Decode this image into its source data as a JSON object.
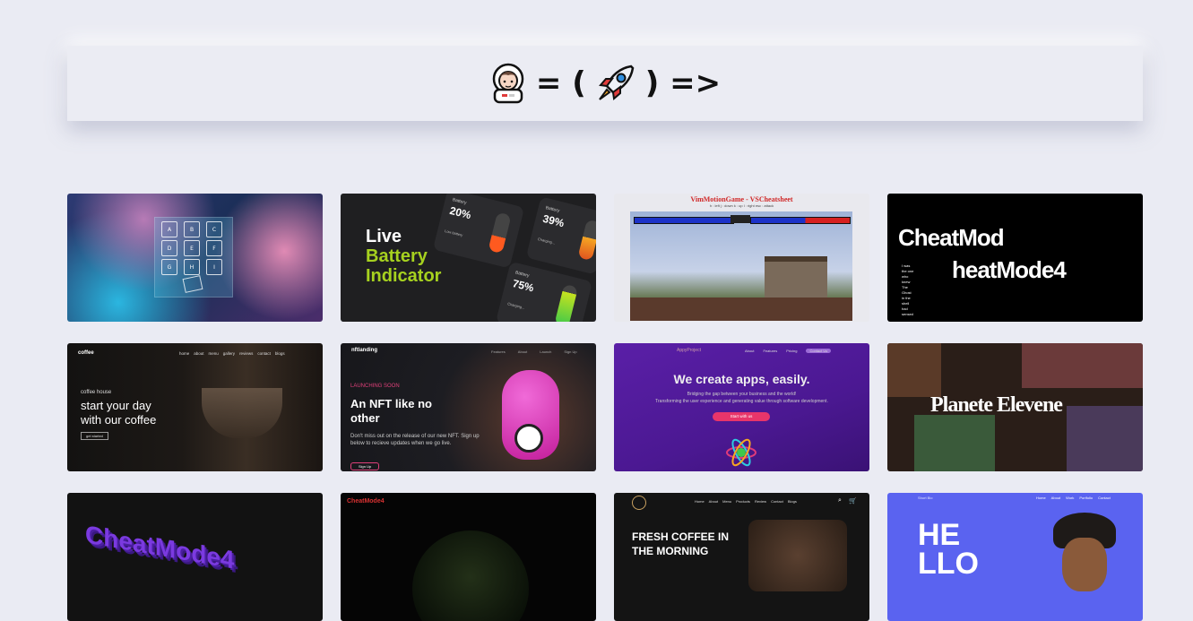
{
  "header": {
    "logo_text": "= (",
    "logo_text_end": ") =>"
  },
  "cards": [
    {
      "name": "keypad-project",
      "keys": [
        "A",
        "B",
        "C",
        "D",
        "E",
        "F",
        "G",
        "H",
        "I"
      ]
    },
    {
      "name": "battery-indicator",
      "title_1": "Live",
      "title_2": "Battery",
      "title_3": "Indicator",
      "b1_label": "Battery",
      "b1_value": "20%",
      "b1_sub": "Low battery",
      "b2_label": "Battery",
      "b2_value": "39%",
      "b2_sub": "Charging...",
      "b3_label": "Battery",
      "b3_value": "75%",
      "b3_sub": "Charging..."
    },
    {
      "name": "vim-motion-game",
      "title": "VimMotionGame - VSCheatsheet",
      "keys": "h : left    j : down    k : up    l : right    esc : attack"
    },
    {
      "name": "cheatmode-logo",
      "line1": "CheatMod",
      "line2": "heatMode4",
      "side": "I was the one who knew The Ghost in the shell had sensed"
    },
    {
      "name": "coffee-house",
      "brand": "coffee",
      "nav": [
        "home",
        "about",
        "menu",
        "gallery",
        "reviews",
        "contact",
        "blogs"
      ],
      "eyebrow": "coffee house",
      "headline_1": "start your day",
      "headline_2": "with our coffee",
      "cta": "get started"
    },
    {
      "name": "nft-landing",
      "brand": "nftlanding",
      "nav": [
        "Features",
        "About",
        "Launch",
        "Sign Up"
      ],
      "eyebrow": "LAUNCHING SOON",
      "headline_1": "An NFT like no",
      "headline_2": "other",
      "body": "Don't miss out on the release of our new NFT. Sign up below to recieve updates when we go live.",
      "cta": "Sign Up"
    },
    {
      "name": "apps-agency",
      "brand": "AppyProject",
      "nav": [
        "About",
        "Features",
        "Pricing"
      ],
      "nav_cta": "Contact Us",
      "headline": "We create apps, easily.",
      "sub_1": "Bridging the gap between your business and the world!",
      "sub_2": "Transforming the user experience and generating value through software development.",
      "cta": "Start with us"
    },
    {
      "name": "planete-elevene",
      "headline": "Planete Elevene"
    },
    {
      "name": "cheatmode-3d",
      "text": "CheatMode4"
    },
    {
      "name": "cheatmode-globe",
      "brand": "CheatMode4"
    },
    {
      "name": "fresh-coffee",
      "nav": [
        "Home",
        "About",
        "Menu",
        "Products",
        "Review",
        "Contact",
        "Blogs"
      ],
      "headline_1": "FRESH COFFEE IN",
      "headline_2": "THE MORNING"
    },
    {
      "name": "hello-portfolio",
      "brand": "Short Bio",
      "nav": [
        "Home",
        "About",
        "Work",
        "Portfolio",
        "Contact"
      ],
      "headline_1": "HE",
      "headline_2": "LLO"
    }
  ],
  "colors": {
    "page_bg": "#eaebf3",
    "battery_green": "#a6d11f"
  }
}
